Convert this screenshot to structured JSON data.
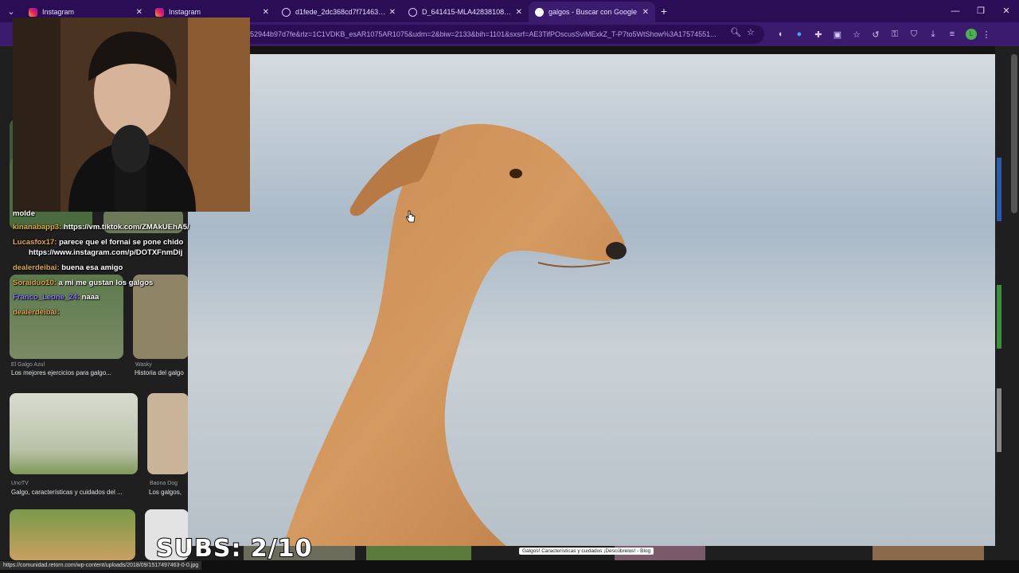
{
  "tabs": [
    {
      "label": "Instagram",
      "icon": "instagram-icon",
      "active": false
    },
    {
      "label": "Instagram",
      "icon": "instagram-icon",
      "active": false
    },
    {
      "label": "d1fede_2dc368cd7f71463cafdd",
      "icon": "globe-icon",
      "active": false
    },
    {
      "label": "D_641415-MLA42838108894_0",
      "icon": "globe-icon",
      "active": false
    },
    {
      "label": "galgos - Buscar con Google",
      "icon": "google-icon",
      "active": true
    }
  ],
  "address_bar": {
    "url": "52944b97d7fe&rlz=1C1VDKB_esAR1075AR1075&udm=2&biw=2133&bih=1101&sxsrf=AE3TifPOscusSviMExkZ_T-P7to5WtShow%3A17574551..."
  },
  "results": [
    {
      "source": "El Galgo Azul",
      "caption": "Los mejores ejercicios para galgo..."
    },
    {
      "source": "Wasky",
      "caption": "Historia del galgo"
    },
    {
      "source": "UnoTV",
      "caption": "Galgo, características y cuidados del ..."
    },
    {
      "source": "Baona Dog",
      "caption": "Los galgos,"
    }
  ],
  "chat": [
    {
      "user": "",
      "message": "molde"
    },
    {
      "user": "kinanabapp3:",
      "message": "https://vm.tiktok.com/ZMAkUEhA5/"
    },
    {
      "user": "Lucasfox17:",
      "message": "parece que el fornai se pone chido"
    },
    {
      "user": "",
      "message": "https://www.instagram.com/p/DOTXFnmDij"
    },
    {
      "user": "dealerdeibai:",
      "message": "buena esa amigo"
    },
    {
      "user": "Soraiduo10:",
      "message": "a mi me gustan los galgos"
    },
    {
      "user": "Franco_Leone_24:",
      "message": "naaa"
    },
    {
      "user": "dealerdeibai:",
      "message": ""
    }
  ],
  "tooltip": "Galgos! Características y cuidados ¡Descúbrelos! - Blog",
  "status_url": "https://comunidad.retorn.com/wp-content/uploads/2018/09/1517497463-0-0.jpg",
  "overlay": {
    "subs": "SUBS:  2/10"
  },
  "colors": {
    "tabbar": "#2a0d55",
    "toolbar": "#3b1b6e",
    "page_bg": "#1f1f1f"
  }
}
